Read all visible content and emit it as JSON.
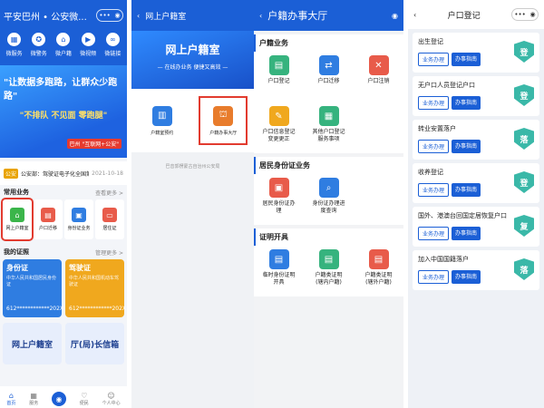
{
  "panel1": {
    "title": "平安巴州 • 公安微...",
    "quick_icons": [
      {
        "label": "微服务",
        "icon": "grid-icon"
      },
      {
        "label": "微警务",
        "icon": "badge-icon"
      },
      {
        "label": "微户籍",
        "icon": "house-icon"
      },
      {
        "label": "微视频",
        "icon": "video-icon"
      },
      {
        "label": "微链接",
        "icon": "link-icon"
      }
    ],
    "banner": {
      "line1": "\"让数据多跑路，让群众少跑路\"",
      "line2": "\"不排队 不见面 零跑腿\"",
      "tag": "巴州 \"互联网+公安\""
    },
    "news": {
      "tag": "公安",
      "text": "公安部：驾驶证电子化全国第...",
      "date": "2021-10-18"
    },
    "common_services": {
      "title": "常用业务",
      "more": "查看更多 >"
    },
    "services": [
      {
        "label": "网上户籍室",
        "color": "#3bb54a",
        "icon": "house-icon"
      },
      {
        "label": "户口迁移",
        "color": "#e85b4a",
        "icon": "doc-icon"
      },
      {
        "label": "身份证业务",
        "color": "#2f7de1",
        "icon": "id-icon"
      },
      {
        "label": "居住证",
        "color": "#e85b4a",
        "icon": "card-icon"
      }
    ],
    "my_certs": {
      "title": "我的证照",
      "more": "管理更多 >"
    },
    "cards": [
      {
        "title": "身份证",
        "sub": "中华人民共和国居民身份证",
        "num": "612************202X",
        "color": "#2f7de1"
      },
      {
        "title": "驾驶证",
        "sub": "中华人民共和国机动车驾驶证",
        "num": "612************202X",
        "color": "#f0a81e"
      }
    ],
    "big_buttons": [
      "网上户籍室",
      "厅(局)长信箱"
    ],
    "tabbar": [
      {
        "label": "首页",
        "icon": "home-icon"
      },
      {
        "label": "服务",
        "icon": "service-icon"
      },
      {
        "label": "",
        "icon": "camera-icon"
      },
      {
        "label": "便民",
        "icon": "people-icon"
      },
      {
        "label": "个人中心",
        "icon": "user-icon"
      }
    ]
  },
  "panel2": {
    "title": "网上户籍室",
    "banner_title": "网上户籍室",
    "banner_sub": "— 在线办业务 便捷又高效 —",
    "items": [
      {
        "label": "户籍室预约",
        "color": "#2f7de1",
        "icon": "building-icon"
      },
      {
        "label": "户籍办事大厅",
        "color": "#e87c2c",
        "icon": "hall-icon"
      }
    ],
    "footer": "巴音郭楞蒙古自治州公安局"
  },
  "panel3": {
    "title": "户籍办事大厅",
    "sections": [
      {
        "title": "户籍业务",
        "items": [
          {
            "label": "户口登记",
            "color": "#36b37e"
          },
          {
            "label": "户口迁移",
            "color": "#2f7de1"
          },
          {
            "label": "户口注销",
            "color": "#e85b4a"
          },
          {
            "label": "户口信息登记\n变更更正",
            "color": "#f0a81e"
          },
          {
            "label": "其他户口登记\n服务事项",
            "color": "#36b37e"
          }
        ]
      },
      {
        "title": "居民身份证业务",
        "items": [
          {
            "label": "居民身份证办\n理",
            "color": "#e85b4a"
          },
          {
            "label": "身份证办理进\n度查询",
            "color": "#2f7de1"
          }
        ]
      },
      {
        "title": "证明开具",
        "items": [
          {
            "label": "临时身份证明\n开具",
            "color": "#2f7de1"
          },
          {
            "label": "户籍类证明\n(辖内户籍)",
            "color": "#36b37e"
          },
          {
            "label": "户籍类证明\n(辖外户籍)",
            "color": "#e85b4a"
          }
        ]
      }
    ]
  },
  "panel4": {
    "title": "户口登记",
    "btn_apply": "业务办理",
    "btn_guide": "办事指南",
    "items": [
      {
        "title": "出生登记",
        "badge": "登",
        "color": "#3ab8a8"
      },
      {
        "title": "无户口人员登记户口",
        "badge": "登",
        "color": "#3ab8a8"
      },
      {
        "title": "转业安置落户",
        "badge": "落",
        "color": "#3ab8a8"
      },
      {
        "title": "收养登记",
        "badge": "登",
        "color": "#3ab8a8"
      },
      {
        "title": "国外、港澳台回国定居恢复户口",
        "badge": "复",
        "color": "#3ab8a8"
      },
      {
        "title": "加入中国国籍落户",
        "badge": "落",
        "color": "#3ab8a8"
      }
    ]
  }
}
